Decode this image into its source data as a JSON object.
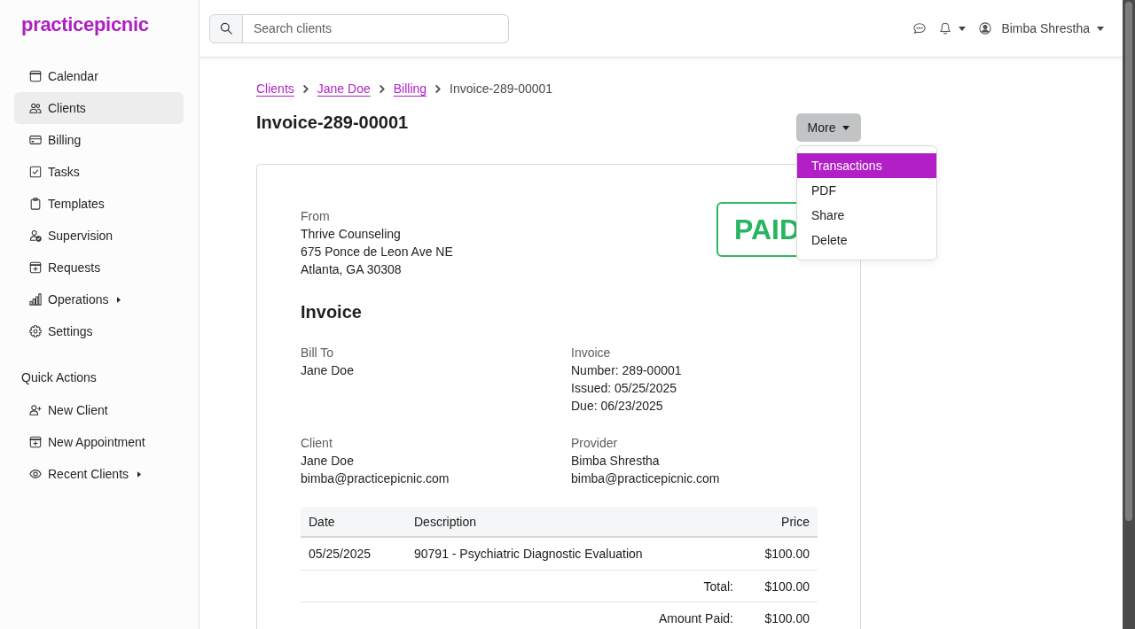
{
  "sidebar": {
    "logo": "practicepicnic",
    "nav": [
      {
        "label": "Calendar",
        "kind": "link",
        "selected": false
      },
      {
        "label": "Clients",
        "kind": "link",
        "selected": true
      },
      {
        "label": "Billing",
        "kind": "link",
        "selected": false
      },
      {
        "label": "Tasks",
        "kind": "link",
        "selected": false
      },
      {
        "label": "Templates",
        "kind": "link",
        "selected": false
      },
      {
        "label": "Supervision",
        "kind": "link",
        "selected": false
      },
      {
        "label": "Requests",
        "kind": "link",
        "selected": false
      },
      {
        "label": "Operations",
        "kind": "submenu",
        "selected": false
      },
      {
        "label": "Settings",
        "kind": "link",
        "selected": false
      }
    ],
    "quick_actions": {
      "title": "Quick Actions",
      "items": [
        {
          "label": "New Client",
          "kind": "link"
        },
        {
          "label": "New Appointment",
          "kind": "link"
        },
        {
          "label": "Recent Clients",
          "kind": "submenu"
        }
      ]
    }
  },
  "topbar": {
    "search": {
      "placeholder": "Search clients"
    },
    "user_name": "Bimba Shrestha"
  },
  "breadcrumb": [
    {
      "label": "Clients",
      "kind": "link"
    },
    {
      "label": "Jane Doe",
      "kind": "link"
    },
    {
      "label": "Billing",
      "kind": "link"
    },
    {
      "label": "Invoice-289-00001",
      "kind": "current"
    }
  ],
  "title": "Invoice-289-00001",
  "more_menu": {
    "label": "More",
    "expanded": true,
    "items": [
      {
        "label": "Transactions",
        "selected": true
      },
      {
        "label": "PDF",
        "selected": false
      },
      {
        "label": "Share",
        "selected": false
      },
      {
        "label": "Delete",
        "selected": false
      }
    ]
  },
  "invoice": {
    "status": "PAID",
    "from": {
      "label": "From",
      "lines": [
        "Thrive Counseling",
        "675 Ponce de Leon Ave NE",
        "Atlanta, GA 30308"
      ]
    },
    "heading": "Invoice",
    "bill_to": {
      "label": "Bill To",
      "lines": [
        "Jane Doe"
      ]
    },
    "details": {
      "label": "Invoice",
      "lines": [
        "Number: 289-00001",
        "Issued: 05/25/2025",
        "Due: 06/23/2025"
      ]
    },
    "client": {
      "label": "Client",
      "lines": [
        "Jane Doe",
        "bimba@practicepicnic.com"
      ]
    },
    "provider": {
      "label": "Provider",
      "lines": [
        "Bimba Shrestha",
        "bimba@practicepicnic.com"
      ]
    },
    "table": {
      "columns": [
        "Date",
        "Description",
        "Price"
      ],
      "rows": [
        [
          "05/25/2025",
          "90791 - Psychiatric Diagnostic Evaluation",
          "$100.00"
        ]
      ],
      "summary": [
        {
          "label": "Total:",
          "value": "$100.00"
        },
        {
          "label": "Amount Paid:",
          "value": "$100.00"
        }
      ]
    }
  }
}
